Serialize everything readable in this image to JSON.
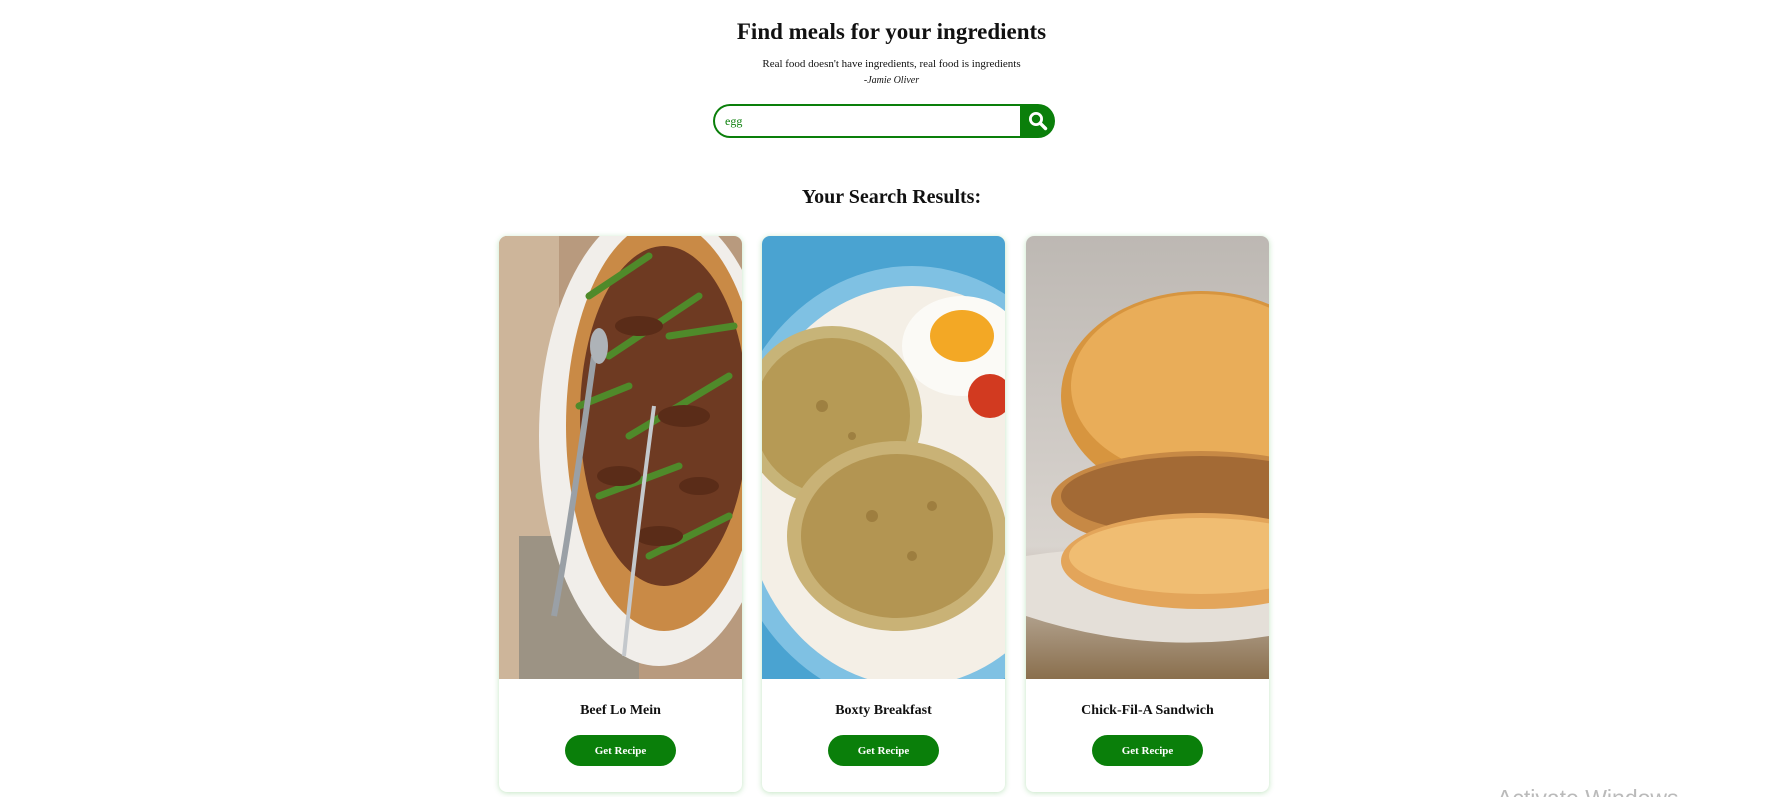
{
  "header": {
    "title": "Find meals for your ingredients",
    "quote": "Real food doesn't have ingredients, real food is ingredients",
    "quote_author": "-Jamie Oliver"
  },
  "search": {
    "value": "egg",
    "button_icon": "search-icon"
  },
  "results": {
    "title": "Your Search Results:",
    "items": [
      {
        "name": "Beef Lo Mein",
        "button_label": "Get Recipe",
        "image": "beef-lo-mein-photo"
      },
      {
        "name": "Boxty Breakfast",
        "button_label": "Get Recipe",
        "image": "boxty-breakfast-photo"
      },
      {
        "name": "Chick-Fil-A Sandwich",
        "button_label": "Get Recipe",
        "image": "chicken-sandwich-photo"
      }
    ]
  },
  "overlay": {
    "watermark": "Activate Windows"
  },
  "colors": {
    "accent": "#0a7f0a",
    "background": "#ffffff",
    "text": "#111111"
  }
}
